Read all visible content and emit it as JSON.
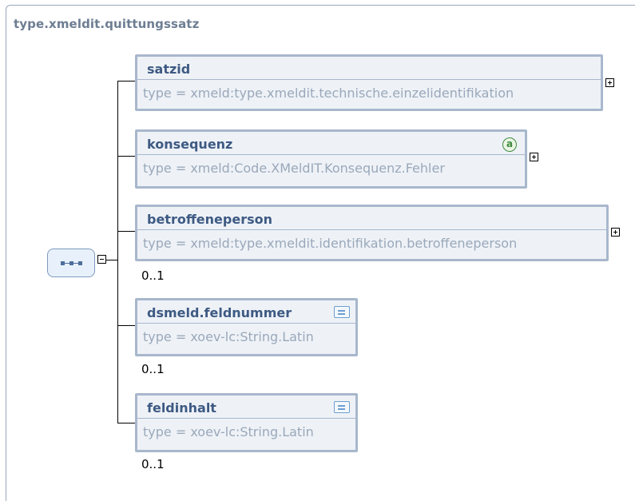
{
  "complex_type": {
    "name": "type.xmeldit.quittungssatz"
  },
  "elements": [
    {
      "name": "satzid",
      "type": "type = xmeld:type.xmeldit.technische.einzelidentifikation",
      "occurrence": "",
      "expandable": true,
      "attribute_badge": ""
    },
    {
      "name": "konsequenz",
      "type": "type = xmeld:Code.XMeldIT.Konsequenz.Fehler",
      "occurrence": "",
      "expandable": true,
      "attribute_badge": "a"
    },
    {
      "name": "betroffeneperson",
      "type": "type = xmeld:type.xmeldit.identifikation.betroffeneperson",
      "occurrence": "0..1",
      "expandable": true,
      "attribute_badge": ""
    },
    {
      "name": "dsmeld.feldnummer",
      "type": "type = xoev-lc:String.Latin",
      "occurrence": "0..1",
      "expandable": false,
      "attribute_badge": "",
      "icon": "documentation-icon"
    },
    {
      "name": "feldinhalt",
      "type": "type = xoev-lc:String.Latin",
      "occurrence": "0..1",
      "expandable": false,
      "attribute_badge": "",
      "icon": "documentation-icon"
    }
  ],
  "compositor": {
    "kind": "sequence",
    "icon": "sequence-icon"
  }
}
